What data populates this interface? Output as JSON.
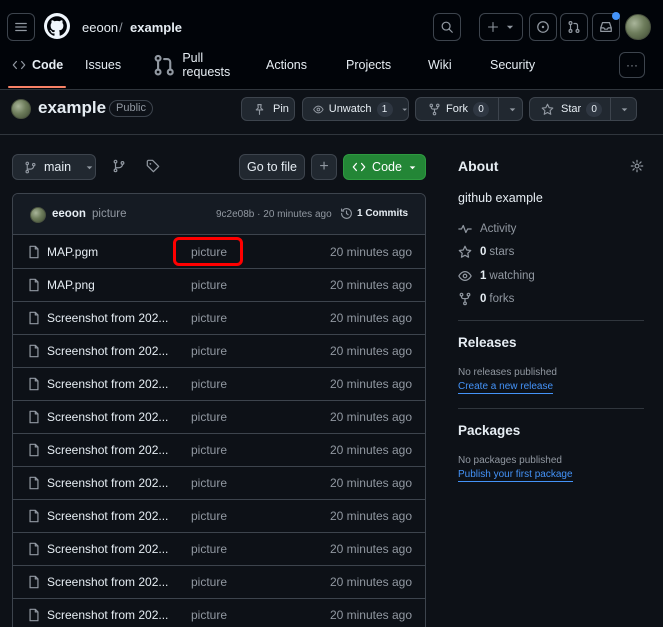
{
  "header": {
    "owner": "eeoon",
    "separator": "/",
    "repo": "example",
    "icons": [
      "hamburger-icon",
      "github-logo-icon",
      "search-icon",
      "plus-icon",
      "caret-down-icon",
      "issue-opened-icon",
      "pull-request-icon",
      "inbox-icon"
    ],
    "notification_color": "#4493f8"
  },
  "nav": {
    "code": "Code",
    "issues": "Issues",
    "pull_requests": "Pull requests",
    "actions": "Actions",
    "projects": "Projects",
    "wiki": "Wiki",
    "security": "Security",
    "more": "···",
    "active_underline_color": "#f78166"
  },
  "repo": {
    "name": "example",
    "visibility": "Public",
    "pin": "Pin",
    "unwatch": "Unwatch",
    "watch_count": "1",
    "fork": "Fork",
    "fork_count": "0",
    "star": "Star",
    "star_count": "0"
  },
  "toolbar": {
    "branch": "main",
    "go_to_file": "Go to file",
    "add": "+",
    "code": "Code",
    "code_button_color": "#238636"
  },
  "commit": {
    "author": "eeoon",
    "message": "picture",
    "meta": "9c2e08b · 20 minutes ago",
    "commits": "1 Commits"
  },
  "files": [
    {
      "name": "MAP.pgm",
      "message": "picture",
      "age": "20 minutes ago"
    },
    {
      "name": "MAP.png",
      "message": "picture",
      "age": "20 minutes ago"
    },
    {
      "name": "Screenshot from 202...",
      "message": "picture",
      "age": "20 minutes ago"
    },
    {
      "name": "Screenshot from 202...",
      "message": "picture",
      "age": "20 minutes ago"
    },
    {
      "name": "Screenshot from 202...",
      "message": "picture",
      "age": "20 minutes ago"
    },
    {
      "name": "Screenshot from 202...",
      "message": "picture",
      "age": "20 minutes ago"
    },
    {
      "name": "Screenshot from 202...",
      "message": "picture",
      "age": "20 minutes ago"
    },
    {
      "name": "Screenshot from 202...",
      "message": "picture",
      "age": "20 minutes ago"
    },
    {
      "name": "Screenshot from 202...",
      "message": "picture",
      "age": "20 minutes ago"
    },
    {
      "name": "Screenshot from 202...",
      "message": "picture",
      "age": "20 minutes ago"
    },
    {
      "name": "Screenshot from 202...",
      "message": "picture",
      "age": "20 minutes ago"
    },
    {
      "name": "Screenshot from 202...",
      "message": "picture",
      "age": "20 minutes ago"
    }
  ],
  "highlight_color": "#ff0000",
  "about": {
    "title": "About",
    "description": "github example",
    "activity": "Activity",
    "stars_count": "0",
    "stars_label": "stars",
    "watching_count": "1",
    "watching_label": "watching",
    "forks_count": "0",
    "forks_label": "forks"
  },
  "releases": {
    "title": "Releases",
    "empty": "No releases published",
    "link": "Create a new release"
  },
  "packages": {
    "title": "Packages",
    "empty": "No packages published",
    "link": "Publish your first package"
  }
}
